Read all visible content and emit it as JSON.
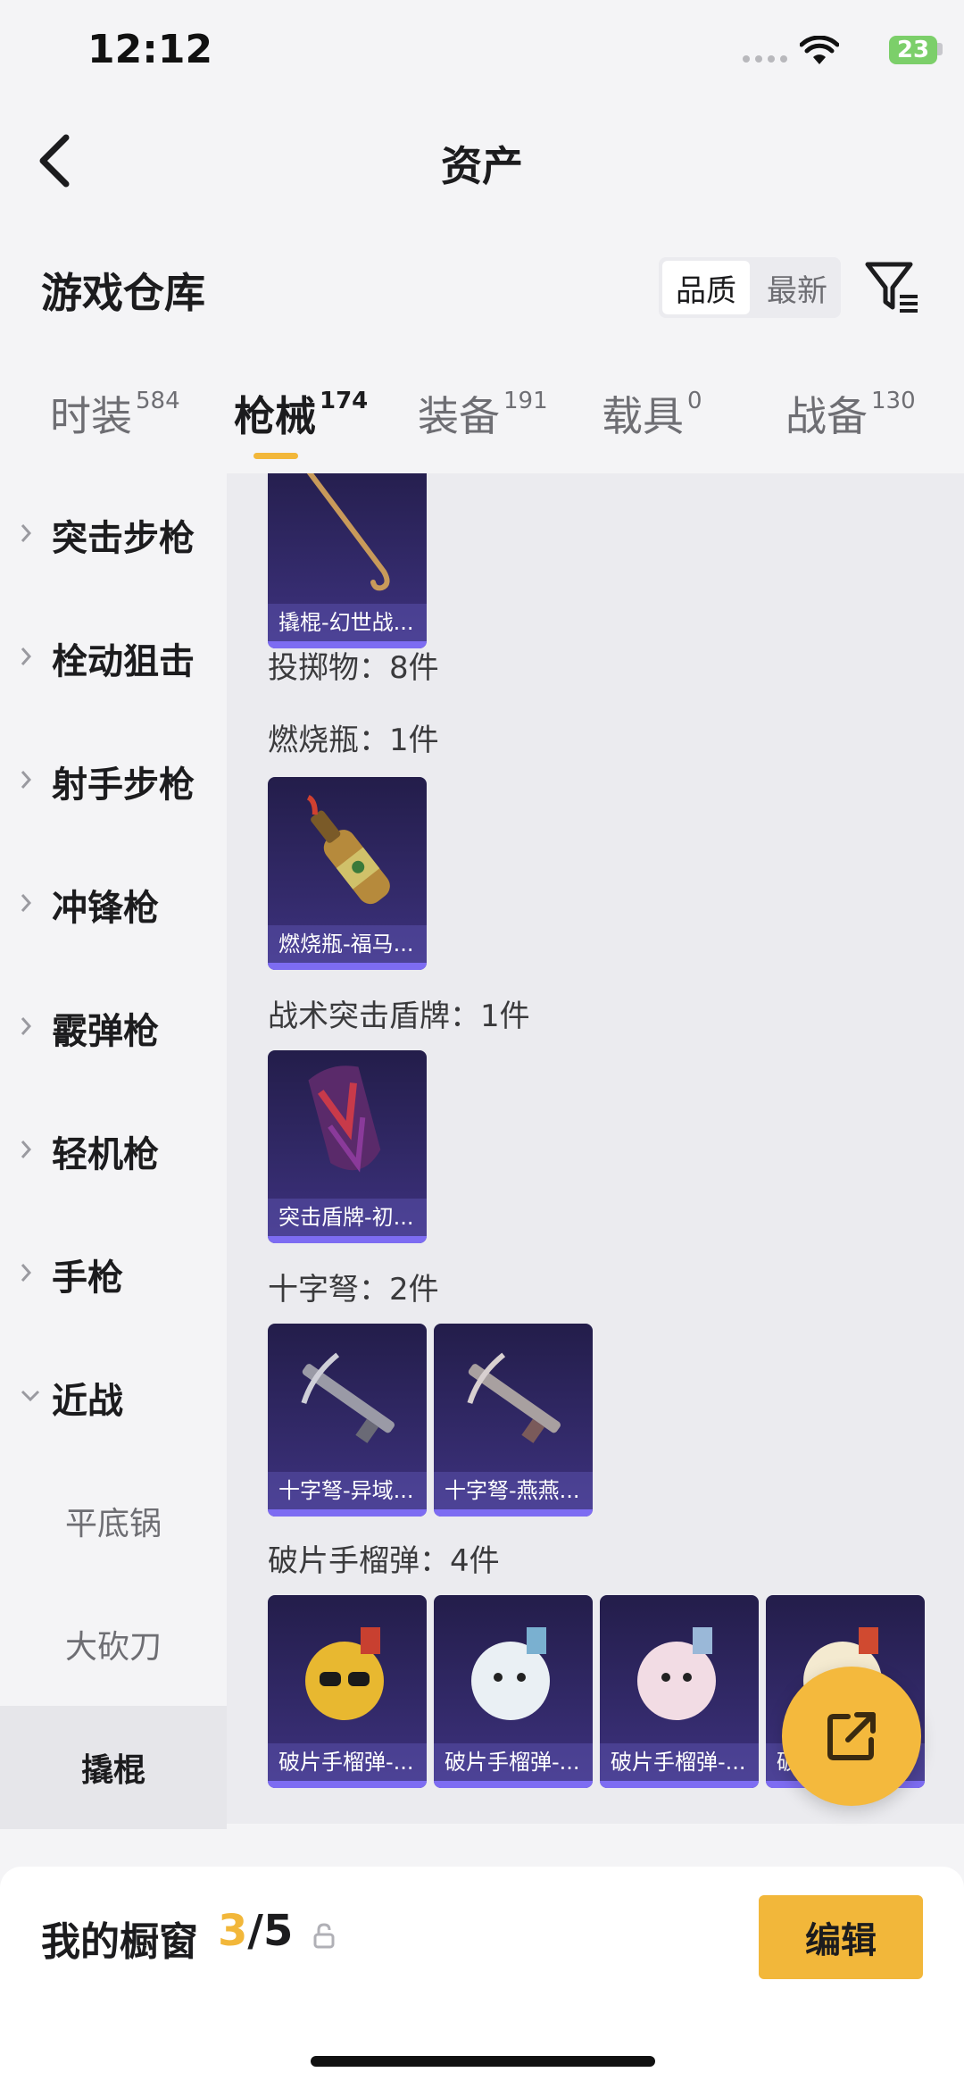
{
  "status": {
    "time": "12:12",
    "battery": "23"
  },
  "nav": {
    "title": "资产"
  },
  "warehouse": {
    "title": "游戏仓库",
    "sort_options": [
      "品质",
      "最新"
    ],
    "active_sort": "品质"
  },
  "tabs": [
    {
      "label": "时装",
      "count": "584"
    },
    {
      "label": "枪械",
      "count": "174"
    },
    {
      "label": "装备",
      "count": "191"
    },
    {
      "label": "载具",
      "count": "0"
    },
    {
      "label": "战备",
      "count": "130"
    }
  ],
  "sidebar": {
    "categories": [
      {
        "label": "突击步枪"
      },
      {
        "label": "栓动狙击"
      },
      {
        "label": "射手步枪"
      },
      {
        "label": "冲锋枪"
      },
      {
        "label": "霰弹枪"
      },
      {
        "label": "轻机枪"
      },
      {
        "label": "手枪"
      },
      {
        "label": "近战"
      }
    ],
    "sub_items": [
      {
        "label": "平底锅"
      },
      {
        "label": "大砍刀"
      },
      {
        "label": "撬棍"
      }
    ]
  },
  "content": {
    "top_card": {
      "caption": "撬棍-幻世战..."
    },
    "throwables_header": "投掷物：8件",
    "sections": [
      {
        "title": "燃烧瓶：1件",
        "cards": [
          {
            "caption": "燃烧瓶-福马...",
            "art": "molotov-icon"
          }
        ]
      },
      {
        "title": "战术突击盾牌：1件",
        "cards": [
          {
            "caption": "突击盾牌-初...",
            "art": "shield-icon"
          }
        ]
      },
      {
        "title": "十字弩：2件",
        "cards": [
          {
            "caption": "十字弩-异域...",
            "art": "crossbow-icon"
          },
          {
            "caption": "十字弩-燕燕...",
            "art": "crossbow-icon"
          }
        ]
      },
      {
        "title": "破片手榴弹：4件",
        "cards": [
          {
            "caption": "破片手榴弹-...",
            "art": "grenade-icon"
          },
          {
            "caption": "破片手榴弹-...",
            "art": "grenade-icon"
          },
          {
            "caption": "破片手榴弹-...",
            "art": "grenade-icon"
          },
          {
            "caption": "破片手榴弹-...",
            "art": "grenade-icon"
          }
        ]
      }
    ]
  },
  "showcase": {
    "title": "我的橱窗",
    "current": "3",
    "total": "/5",
    "edit_label": "编辑"
  },
  "colors": {
    "accent": "#f2b73a",
    "card_bg": "#2b2459",
    "card_bar": "#7d6cf2"
  }
}
